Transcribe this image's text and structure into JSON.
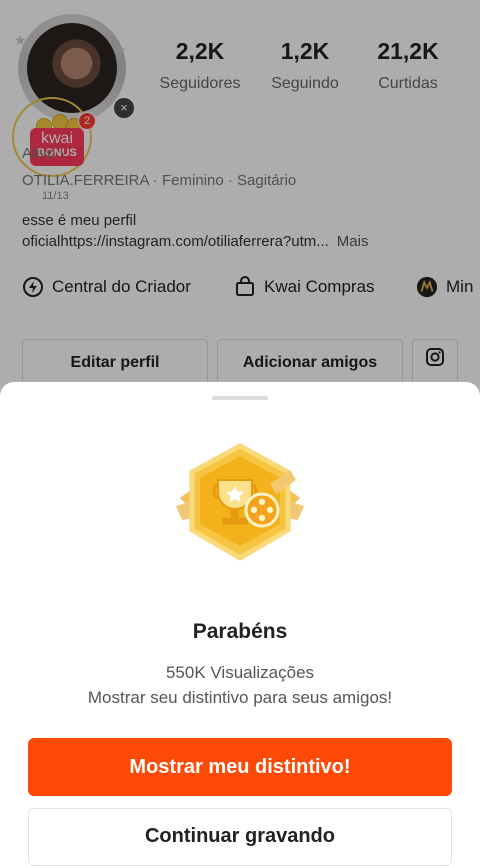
{
  "profile": {
    "stats": [
      {
        "value": "2,2K",
        "label": "Seguidores"
      },
      {
        "value": "1,2K",
        "label": "Seguindo"
      },
      {
        "value": "21,2K",
        "label": "Curtidas"
      }
    ],
    "kwai_bonus": {
      "line1": "kwai",
      "line2": "BONUS",
      "progress": "11/13",
      "badge_count": "2"
    },
    "edit_hint": "Ativo ›",
    "meta": "OTILIA.FERREIRA · Feminino · Sagitário",
    "bio_line1": "esse é meu perfil",
    "bio_line2": "oficialhttps://instagram.com/otiliaferrera?utm...",
    "bio_more": "Mais",
    "links": [
      {
        "icon": "lightning-circle-icon",
        "label": "Central do Criador"
      },
      {
        "icon": "shopping-bag-icon",
        "label": "Kwai Compras"
      },
      {
        "icon": "mini-logo-icon",
        "label": "Min"
      }
    ],
    "buttons": {
      "edit": "Editar perfil",
      "add_friends": "Adicionar amigos",
      "instagram_icon": "instagram-icon"
    }
  },
  "sheet": {
    "badge_icon": "trophy-film-badge-icon",
    "title": "Parabéns",
    "subtitle1": "550K Visualizações",
    "subtitle2": "Mostrar seu distintivo para seus amigos!",
    "primary_label": "Mostrar meu distintivo!",
    "secondary_label": "Continuar gravando",
    "colors": {
      "primary": "#ff4906",
      "badge_gold": "#f5b914"
    }
  }
}
